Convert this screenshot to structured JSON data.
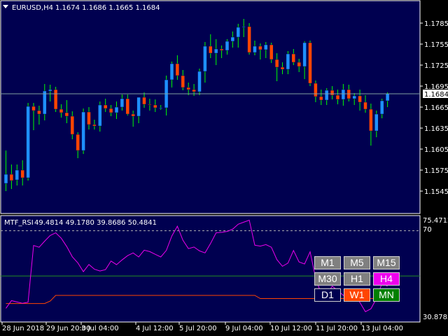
{
  "window": {
    "title": "EURUSD,H4",
    "ohlc": [
      "1.1674",
      "1.1686",
      "1.1665",
      "1.1684"
    ],
    "current_price": "1.1684"
  },
  "colors": {
    "background": "#000000",
    "plot_bg": "#000050",
    "bull_body": "#1e90ff",
    "bear_body": "#ff4500",
    "wick": "#00ff00",
    "grid_line": "#7f9f9f",
    "rsi_line": "#ee00ee",
    "rsi_ma_line": "#ff4500",
    "rsi_level_70": "#b0b0b0",
    "rsi_level_50": "#228b22"
  },
  "price_axis": {
    "labels": [
      "1.1785",
      "1.1755",
      "1.1725",
      "1.1695",
      "1.1665",
      "1.1635",
      "1.1605",
      "1.1575",
      "1.1545"
    ]
  },
  "rsi": {
    "label": "MTF_RSI",
    "values": [
      "49.4814",
      "49.1780",
      "39.8686",
      "50.4841"
    ],
    "axis": {
      "top": "75.4712",
      "level": "70",
      "bottom": "30.8785"
    }
  },
  "time_axis": {
    "labels": [
      "28 Jun 2018",
      "29 Jun 20:00",
      "3 Jul 04:00",
      "4 Jul 12:00",
      "5 Jul 20:00",
      "9 Jul 04:00",
      "10 Jul 12:00",
      "11 Jul 20:00",
      "13 Jul 04:00"
    ]
  },
  "timeframes": [
    {
      "label": "M1",
      "bg": "#808080",
      "fg": "#ffffff"
    },
    {
      "label": "M5",
      "bg": "#808080",
      "fg": "#ffffff"
    },
    {
      "label": "M15",
      "bg": "#808080",
      "fg": "#ffffff"
    },
    {
      "label": "M30",
      "bg": "#808080",
      "fg": "#ffffff"
    },
    {
      "label": "H1",
      "bg": "#808080",
      "fg": "#ffffff"
    },
    {
      "label": "H4",
      "bg": "#ee00ee",
      "fg": "#ffffff"
    },
    {
      "label": "D1",
      "bg": "#000050",
      "fg": "#ffffff"
    },
    {
      "label": "W1",
      "bg": "#ff4500",
      "fg": "#ffffff"
    },
    {
      "label": "MN",
      "bg": "#008000",
      "fg": "#ffffff"
    }
  ],
  "chart_data": {
    "type": "candlestick",
    "symbol": "EURUSD",
    "timeframe": "H4",
    "ylim": [
      1.1535,
      1.1805
    ],
    "candles": [
      [
        1.1556,
        1.1603,
        1.1545,
        1.1569
      ],
      [
        1.1569,
        1.1583,
        1.1548,
        1.156
      ],
      [
        1.1561,
        1.1583,
        1.1553,
        1.1575
      ],
      [
        1.1575,
        1.1589,
        1.1553,
        1.1564
      ],
      [
        1.1564,
        1.1671,
        1.156,
        1.1666
      ],
      [
        1.1666,
        1.1671,
        1.1632,
        1.166
      ],
      [
        1.166,
        1.1667,
        1.164,
        1.1655
      ],
      [
        1.1655,
        1.1698,
        1.1646,
        1.1688
      ],
      [
        1.1688,
        1.1697,
        1.1673,
        1.169
      ],
      [
        1.169,
        1.1694,
        1.1658,
        1.1662
      ],
      [
        1.1662,
        1.1669,
        1.165,
        1.1657
      ],
      [
        1.1657,
        1.1675,
        1.1642,
        1.1652
      ],
      [
        1.1652,
        1.1659,
        1.1619,
        1.1626
      ],
      [
        1.1626,
        1.1629,
        1.1592,
        1.1603
      ],
      [
        1.1603,
        1.1663,
        1.1598,
        1.1658
      ],
      [
        1.1658,
        1.1665,
        1.1633,
        1.164
      ],
      [
        1.164,
        1.1647,
        1.1633,
        1.1638
      ],
      [
        1.1638,
        1.1673,
        1.163,
        1.1668
      ],
      [
        1.1668,
        1.1677,
        1.1658,
        1.1663
      ],
      [
        1.1663,
        1.1668,
        1.1652,
        1.1657
      ],
      [
        1.1657,
        1.1673,
        1.1648,
        1.1665
      ],
      [
        1.1665,
        1.1683,
        1.166,
        1.1677
      ],
      [
        1.1677,
        1.1683,
        1.1653,
        1.1655
      ],
      [
        1.1655,
        1.166,
        1.1637,
        1.1652
      ],
      [
        1.1652,
        1.1672,
        1.1642,
        1.1679
      ],
      [
        1.1679,
        1.1686,
        1.1664,
        1.1669
      ],
      [
        1.1669,
        1.1677,
        1.166,
        1.1668
      ],
      [
        1.1668,
        1.1676,
        1.1658,
        1.1664
      ],
      [
        1.1664,
        1.1668,
        1.1661,
        1.1664
      ],
      [
        1.1664,
        1.171,
        1.1653,
        1.1704
      ],
      [
        1.1704,
        1.173,
        1.1693,
        1.1727
      ],
      [
        1.1727,
        1.1739,
        1.1704,
        1.171
      ],
      [
        1.171,
        1.1718,
        1.1689,
        1.1693
      ],
      [
        1.1693,
        1.17,
        1.1682,
        1.169
      ],
      [
        1.169,
        1.1698,
        1.1681,
        1.1687
      ],
      [
        1.1687,
        1.172,
        1.1682,
        1.1716
      ],
      [
        1.1716,
        1.1758,
        1.17,
        1.1752
      ],
      [
        1.1752,
        1.1769,
        1.1735,
        1.1742
      ],
      [
        1.1742,
        1.1762,
        1.1725,
        1.1748
      ],
      [
        1.1748,
        1.1753,
        1.1735,
        1.1746
      ],
      [
        1.1746,
        1.1762,
        1.174,
        1.1759
      ],
      [
        1.1759,
        1.1773,
        1.175,
        1.1765
      ],
      [
        1.1765,
        1.1784,
        1.175,
        1.1779
      ],
      [
        1.1779,
        1.1791,
        1.1765,
        1.178
      ],
      [
        1.178,
        1.1785,
        1.174,
        1.1743
      ],
      [
        1.1743,
        1.176,
        1.1739,
        1.1752
      ],
      [
        1.1752,
        1.1756,
        1.1733,
        1.1747
      ],
      [
        1.1747,
        1.1758,
        1.1735,
        1.1754
      ],
      [
        1.1754,
        1.1757,
        1.1728,
        1.1733
      ],
      [
        1.1733,
        1.1742,
        1.1702,
        1.1722
      ],
      [
        1.1722,
        1.1729,
        1.1712,
        1.1719
      ],
      [
        1.1719,
        1.1745,
        1.1712,
        1.1741
      ],
      [
        1.1741,
        1.1748,
        1.1725,
        1.1729
      ],
      [
        1.1729,
        1.1734,
        1.1715,
        1.1723
      ],
      [
        1.1723,
        1.1759,
        1.1705,
        1.1757
      ],
      [
        1.1757,
        1.176,
        1.1695,
        1.1699
      ],
      [
        1.1699,
        1.1703,
        1.1672,
        1.168
      ],
      [
        1.168,
        1.169,
        1.1668,
        1.1675
      ],
      [
        1.1675,
        1.1692,
        1.1668,
        1.1689
      ],
      [
        1.1689,
        1.1695,
        1.1676,
        1.1682
      ],
      [
        1.1682,
        1.169,
        1.1669,
        1.1676
      ],
      [
        1.1676,
        1.1698,
        1.1667,
        1.169
      ],
      [
        1.169,
        1.1697,
        1.1673,
        1.1677
      ],
      [
        1.1677,
        1.1685,
        1.1668,
        1.1681
      ],
      [
        1.1681,
        1.169,
        1.166,
        1.1672
      ],
      [
        1.1672,
        1.1682,
        1.1657,
        1.1662
      ],
      [
        1.1662,
        1.167,
        1.161,
        1.1631
      ],
      [
        1.1631,
        1.166,
        1.1622,
        1.1655
      ],
      [
        1.1655,
        1.1677,
        1.1649,
        1.1674
      ],
      [
        1.1674,
        1.1686,
        1.1665,
        1.1684
      ]
    ],
    "rsi_ylim": [
      30.8785,
      75.4712
    ],
    "rsi_levels": [
      70,
      50
    ],
    "rsi_line": [
      35.7,
      39.1,
      38.5,
      37.9,
      38.4,
      63.5,
      62.7,
      65.4,
      67.9,
      69.1,
      66.7,
      63.0,
      58.5,
      55.8,
      51.9,
      55.1,
      53.0,
      52.2,
      52.8,
      56.6,
      55.0,
      57.1,
      59.0,
      60.2,
      58.4,
      61.4,
      60.8,
      59.6,
      58.4,
      61.3,
      67.7,
      72.0,
      65.8,
      62.1,
      62.8,
      61.1,
      60.2,
      64.4,
      69.1,
      69.3,
      69.7,
      70.7,
      72.9,
      73.8,
      74.7,
      63.6,
      63.2,
      63.9,
      62.7,
      57.2,
      54.3,
      55.7,
      61.3,
      56.2,
      55.3,
      60.7,
      49.1,
      42.1,
      41.7,
      45.5,
      43.6,
      41.4,
      43.5,
      41.7,
      38.3,
      34.2,
      35.5,
      40.0,
      46.8,
      45.5
    ],
    "rsi_ma_line": [
      37.8,
      37.8,
      37.8,
      37.8,
      37.8,
      37.8,
      37.8,
      37.8,
      38.9,
      41.4,
      41.4,
      41.4,
      41.4,
      41.4,
      41.4,
      41.4,
      41.4,
      41.4,
      41.4,
      41.4,
      41.4,
      41.4,
      41.4,
      41.4,
      41.4,
      41.4,
      41.4,
      41.4,
      41.4,
      41.4,
      41.4,
      41.4,
      41.4,
      41.4,
      41.4,
      41.4,
      41.4,
      41.4,
      41.4,
      41.4,
      41.4,
      41.4,
      41.4,
      41.4,
      41.4,
      41.4,
      40.0,
      40.0,
      40.0,
      40.0,
      40.0,
      40.0,
      40.0,
      40.0,
      40.0,
      40.0,
      40.0,
      40.0,
      40.0,
      40.0,
      40.0,
      40.0,
      40.0,
      40.0,
      40.0,
      40.0,
      40.0,
      40.0,
      40.0,
      40.0
    ]
  }
}
